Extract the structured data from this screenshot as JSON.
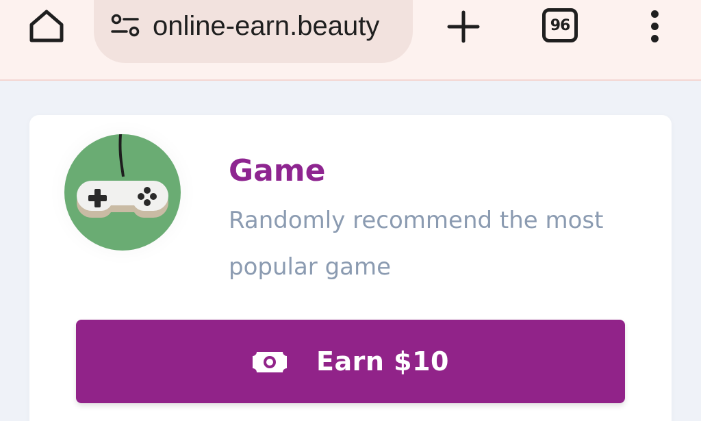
{
  "browser": {
    "url": "online-earn.beauty",
    "tab_count": "96",
    "icons": {
      "home": "home-icon",
      "site_settings": "tune-icon",
      "new_tab": "plus-icon",
      "tabs": "tab-switcher-icon",
      "menu": "more-vert-icon"
    },
    "colors": {
      "toolbar_bg": "#fdf2ef",
      "url_pill_bg": "#f2e2de"
    }
  },
  "card": {
    "title": "Game",
    "description": "Randomly recommend the most popular game",
    "image": "gamepad-icon",
    "button": {
      "label": "Earn $10",
      "icon": "cash-icon"
    },
    "colors": {
      "title": "#8e2590",
      "description": "#8b9bb1",
      "button_bg": "#912389",
      "avatar_bg": "#6aac73"
    }
  }
}
